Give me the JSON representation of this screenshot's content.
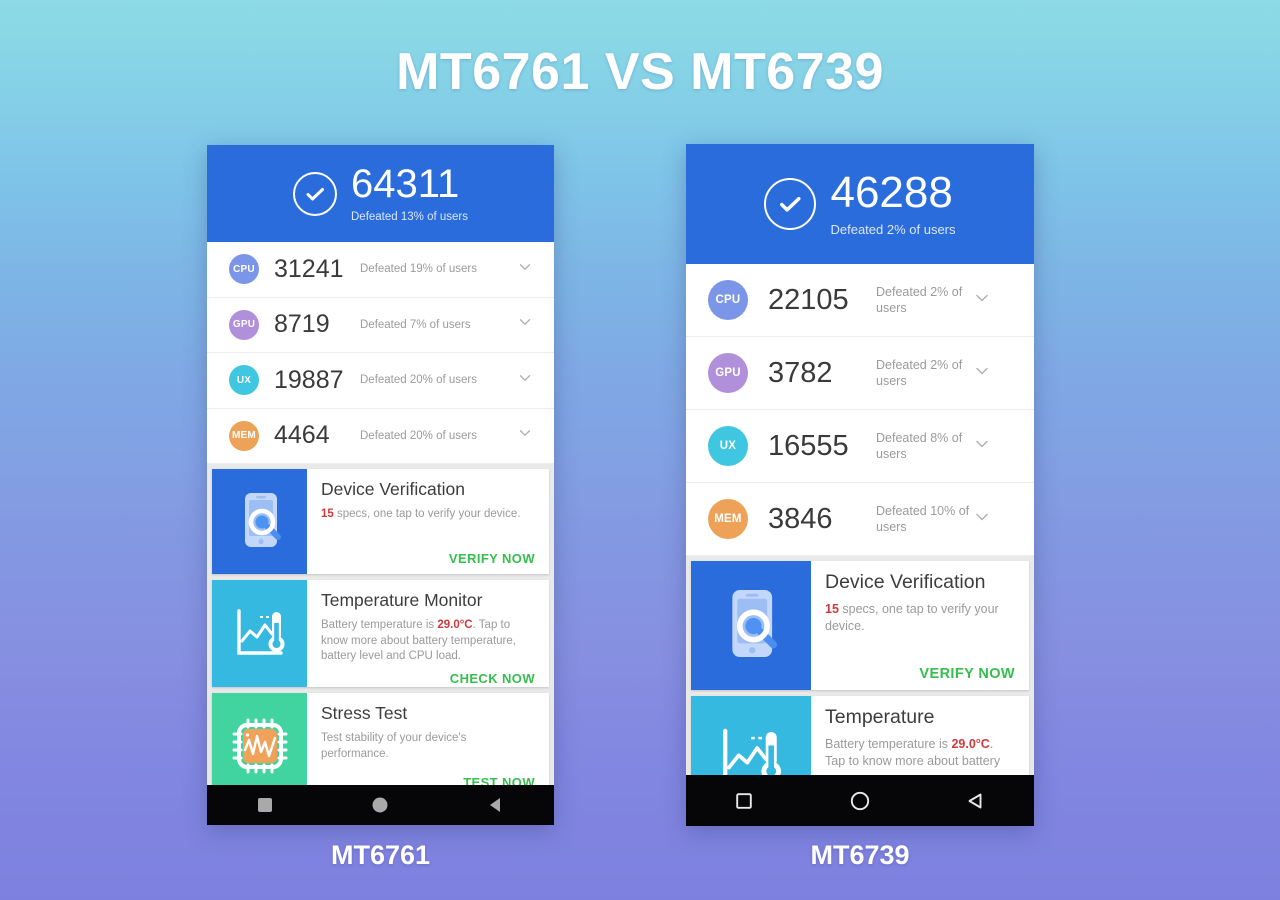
{
  "title": "MT6761 VS MT6739",
  "colors": {
    "header_blue": "#2a6cdc",
    "accent_green": "#35bf4e",
    "accent_red": "#d03a3a",
    "bg_top": "#8ddbe6",
    "bg_bottom": "#7e80df",
    "cpu_badge": "#7b96e8",
    "gpu_badge": "#b08fdb",
    "ux_badge": "#3fc6e0",
    "mem_badge": "#eda257"
  },
  "phones": [
    {
      "caption": "MT6761",
      "header": {
        "total_score": "64311",
        "defeated": "Defeated 13% of users",
        "check_icon": "check-circle-icon"
      },
      "metrics": [
        {
          "label": "CPU",
          "value": "31241",
          "defeated": "Defeated 19% of users",
          "color": "#7b96e8",
          "chevron": "chevron-down-icon"
        },
        {
          "label": "GPU",
          "value": "8719",
          "defeated": "Defeated 7% of users",
          "color": "#b08fdb",
          "chevron": "chevron-down-icon"
        },
        {
          "label": "UX",
          "value": "19887",
          "defeated": "Defeated 20% of users",
          "color": "#3fc6e0",
          "chevron": "chevron-down-icon"
        },
        {
          "label": "MEM",
          "value": "4464",
          "defeated": "Defeated 20% of users",
          "color": "#eda257",
          "chevron": "chevron-down-icon"
        }
      ],
      "cards": [
        {
          "title": "Device Verification",
          "highlight": "15",
          "desc": " specs, one tap to verify your device.",
          "action": "VERIFY NOW",
          "art": "phone-magnifier-icon",
          "art_bg": "#2a6cdc"
        },
        {
          "title": "Temperature Monitor",
          "desc_pre": "Battery temperature is ",
          "highlight": "29.0°C",
          "desc_post": ". Tap to know more about battery temperature, battery level and CPU load.",
          "action": "CHECK NOW",
          "art": "thermometer-chart-icon",
          "art_bg": "#35b9e0"
        },
        {
          "title": "Stress Test",
          "desc": "Test stability of your device's performance.",
          "action": "TEST NOW",
          "art": "cpu-waveform-icon",
          "art_bg": "#42d4a0"
        }
      ],
      "nav": {
        "recent": "square-icon",
        "home": "circle-icon",
        "back": "triangle-back-icon",
        "style": "filled"
      }
    },
    {
      "caption": "MT6739",
      "header": {
        "total_score": "46288",
        "defeated": "Defeated 2% of users",
        "check_icon": "check-circle-icon"
      },
      "metrics": [
        {
          "label": "CPU",
          "value": "22105",
          "defeated": "Defeated 2% of users",
          "color": "#7b96e8",
          "chevron": "chevron-down-icon"
        },
        {
          "label": "GPU",
          "value": "3782",
          "defeated": "Defeated 2% of users",
          "color": "#b08fdb",
          "chevron": "chevron-down-icon"
        },
        {
          "label": "UX",
          "value": "16555",
          "defeated": "Defeated 8% of users",
          "color": "#3fc6e0",
          "chevron": "chevron-down-icon"
        },
        {
          "label": "MEM",
          "value": "3846",
          "defeated": "Defeated 10% of users",
          "color": "#eda257",
          "chevron": "chevron-down-icon"
        }
      ],
      "cards": [
        {
          "title": "Device Verification",
          "highlight": "15",
          "desc": " specs, one tap to verify your device.",
          "action": "VERIFY NOW",
          "art": "phone-magnifier-icon",
          "art_bg": "#2a6cdc"
        },
        {
          "title": "Temperature",
          "desc_pre": "Battery temperature is ",
          "highlight": "29.0°C",
          "desc_post": ". Tap to know more about battery",
          "art": "thermometer-chart-icon",
          "art_bg": "#35b9e0"
        }
      ],
      "nav": {
        "recent": "square-icon",
        "home": "circle-icon",
        "back": "triangle-back-icon",
        "style": "outlined"
      }
    }
  ]
}
